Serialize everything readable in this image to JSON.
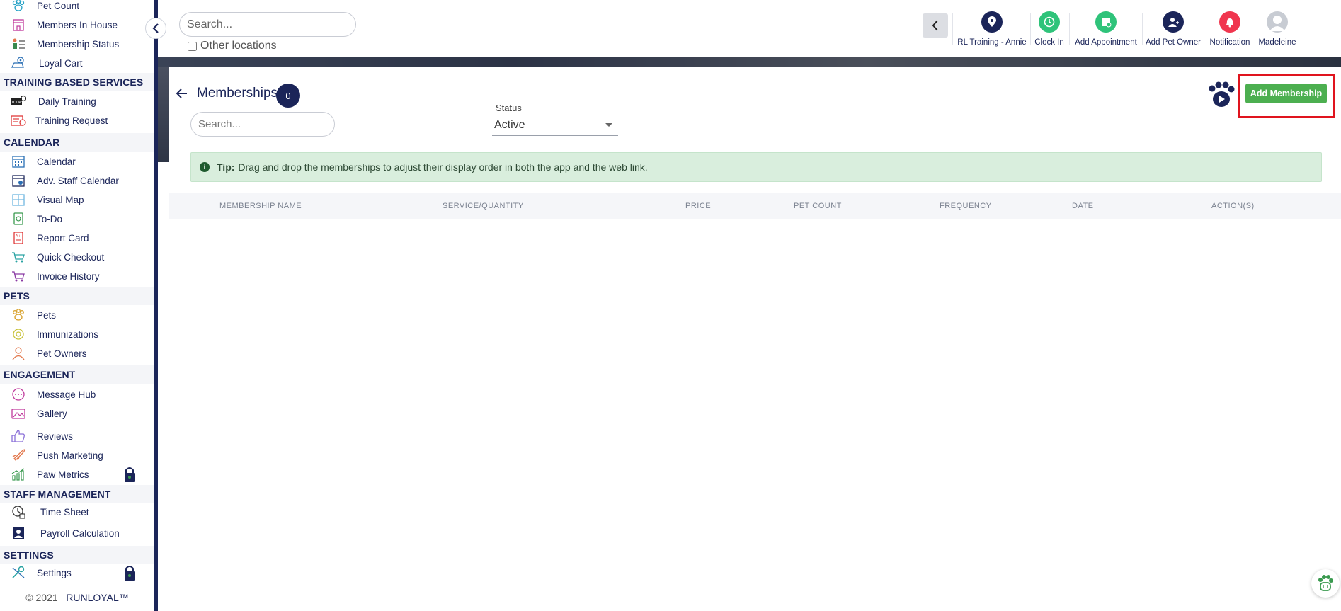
{
  "sidebar": {
    "items_top": [
      {
        "label": "Pet Count",
        "icon": "paw-count-icon"
      },
      {
        "label": "Members In House",
        "icon": "building-icon"
      },
      {
        "label": "Membership Status",
        "icon": "membership-status-icon"
      },
      {
        "label": "Loyal Cart",
        "icon": "loyal-cart-icon"
      }
    ],
    "sections": [
      {
        "title": "TRAINING BASED SERVICES",
        "items": [
          {
            "label": "Daily Training",
            "icon": "daily-training-icon"
          },
          {
            "label": "Training Request",
            "icon": "training-request-icon"
          }
        ]
      },
      {
        "title": "CALENDAR",
        "items": [
          {
            "label": "Calendar",
            "icon": "calendar-icon"
          },
          {
            "label": "Adv. Staff Calendar",
            "icon": "staff-calendar-icon"
          },
          {
            "label": "Visual Map",
            "icon": "visual-map-icon"
          },
          {
            "label": "To-Do",
            "icon": "todo-icon"
          },
          {
            "label": "Report Card",
            "icon": "report-card-icon"
          },
          {
            "label": "Quick Checkout",
            "icon": "cart-icon"
          },
          {
            "label": "Invoice History",
            "icon": "invoice-history-icon"
          }
        ]
      },
      {
        "title": "PETS",
        "items": [
          {
            "label": "Pets",
            "icon": "paw-icon"
          },
          {
            "label": "Immunizations",
            "icon": "immunization-icon"
          },
          {
            "label": "Pet Owners",
            "icon": "person-icon"
          }
        ]
      },
      {
        "title": "ENGAGEMENT",
        "items": [
          {
            "label": "Message Hub",
            "icon": "chat-icon"
          },
          {
            "label": "Gallery",
            "icon": "gallery-icon"
          },
          {
            "label": "Reviews",
            "icon": "thumbs-up-icon"
          },
          {
            "label": "Push Marketing",
            "icon": "rocket-icon"
          },
          {
            "label": "Paw Metrics",
            "icon": "metrics-icon",
            "locked": true
          }
        ]
      },
      {
        "title": "STAFF MANAGEMENT",
        "items": [
          {
            "label": "Time Sheet",
            "icon": "timesheet-icon"
          },
          {
            "label": "Payroll Calculation",
            "icon": "payroll-icon"
          }
        ]
      },
      {
        "title": "SETTINGS",
        "items": [
          {
            "label": "Settings",
            "icon": "wrench-icon",
            "locked": true
          }
        ]
      }
    ],
    "footer": {
      "copyright": "© 2021",
      "brand": "RUNLOYAL™"
    }
  },
  "topbar": {
    "search_placeholder": "Search...",
    "other_locations_label": "Other locations",
    "actions": [
      {
        "label": "RL Training - Annie",
        "icon": "location-pin-icon",
        "color": "#1b2559"
      },
      {
        "label": "Clock In",
        "icon": "clock-icon",
        "color": "#2fc37a"
      },
      {
        "label": "Add Appointment",
        "icon": "add-appointment-icon",
        "color": "#2fc37a"
      },
      {
        "label": "Add Pet Owner",
        "icon": "add-person-icon",
        "color": "#1b2559"
      },
      {
        "label": "Notification",
        "icon": "bell-icon",
        "color": "#f0364f"
      },
      {
        "label": "Madeleine",
        "icon": "avatar-icon",
        "color": "#b8bcc4"
      }
    ]
  },
  "main": {
    "title": "Memberships",
    "count": "0",
    "search_placeholder": "Search...",
    "status_label": "Status",
    "status_value": "Active",
    "add_button": "Add Membership",
    "tip_label": "Tip:",
    "tip_text": "Drag and drop the memberships to adjust their display order in both the app and the web link.",
    "columns": [
      "MEMBERSHIP NAME",
      "SERVICE/QUANTITY",
      "PRICE",
      "PET COUNT",
      "FREQUENCY",
      "DATE",
      "ACTION(S)"
    ],
    "rows": []
  },
  "colors": {
    "navy": "#1b2559",
    "green": "#4caf50",
    "highlight_red": "#e0141e",
    "tip_bg": "#d9eedd"
  }
}
